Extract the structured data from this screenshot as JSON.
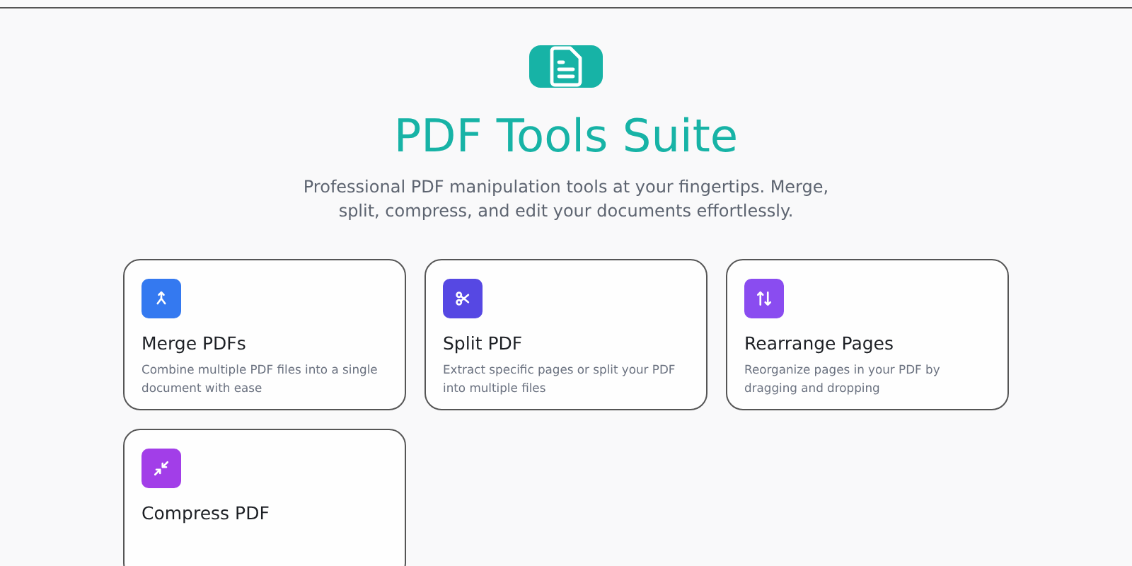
{
  "header": {
    "title": "PDF Tools Suite",
    "subtitle": "Professional PDF manipulation tools at your fingertips. Merge, split, compress, and edit your documents effortlessly."
  },
  "tools": [
    {
      "kind": "merge",
      "title": "Merge PDFs",
      "description": "Combine multiple PDF files into a single document with ease",
      "color": "#3479f0"
    },
    {
      "kind": "split",
      "title": "Split PDF",
      "description": "Extract specific pages or split your PDF into multiple files",
      "color": "#5648e3"
    },
    {
      "kind": "rearrange",
      "title": "Rearrange Pages",
      "description": "Reorganize pages in your PDF by dragging and dropping",
      "color": "#8a4cf0"
    },
    {
      "kind": "compress",
      "title": "Compress PDF",
      "color": "#a23ee8"
    }
  ]
}
